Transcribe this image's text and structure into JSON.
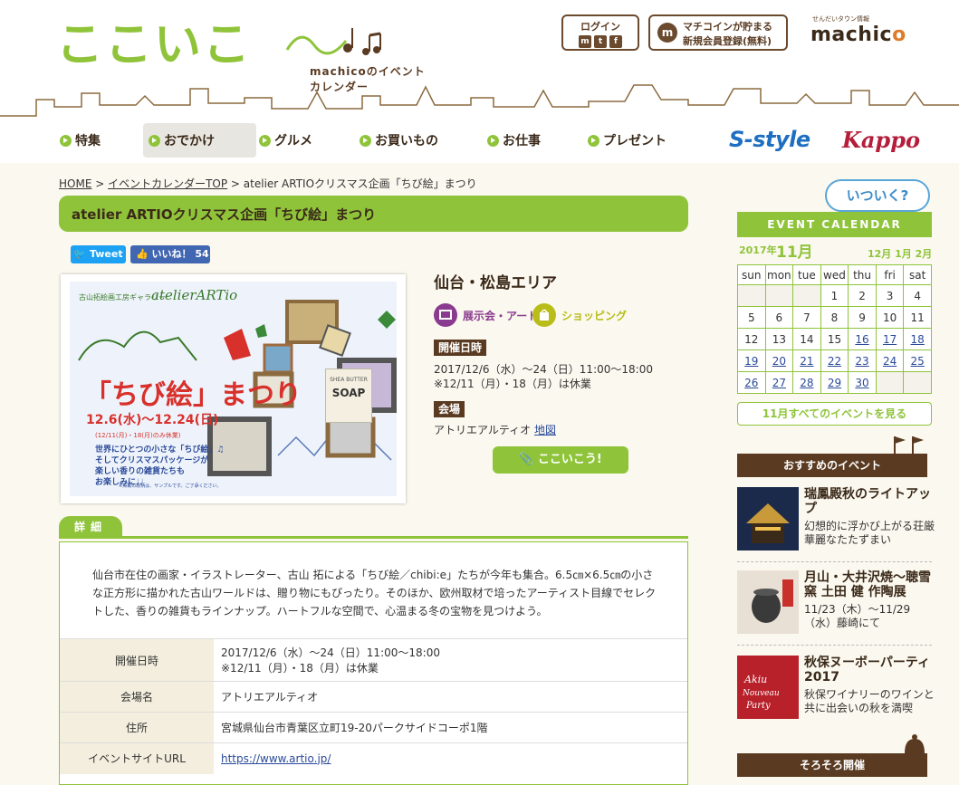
{
  "header": {
    "logo_text": "ここいこ",
    "logo_sub": "machicoのイベントカレンダー",
    "login_label": "ログイン",
    "login_icons": [
      "m",
      "t",
      "f"
    ],
    "register_line1": "マチコインが貯まる",
    "register_line2": "新規会員登録(無料)",
    "machico_small": "せんだいタウン情報",
    "machico_name_a": "machic",
    "machico_name_b": "o"
  },
  "nav": {
    "items": [
      "特集",
      "おでかけ",
      "グルメ",
      "お買いもの",
      "お仕事",
      "プレゼント"
    ],
    "sstyle": "S-style",
    "kappo": "Kappo"
  },
  "breadcrumb": {
    "home": "HOME",
    "sep": " > ",
    "calendar_top": "イベントカレンダーTOP",
    "current": "atelier ARTIOクリスマス企画「ちび絵」まつり"
  },
  "event": {
    "title": "atelier ARTIOクリスマス企画「ちび絵」まつり",
    "tweet_label": "Tweet",
    "like_label": "いいね！ 54",
    "area": "仙台・松島エリア",
    "categories": [
      {
        "label": "展示会・アート",
        "color": "#8a3b8f"
      },
      {
        "label": "ショッピング",
        "color": "#b8bd1a"
      }
    ],
    "date_label": "開催日時",
    "date_line1": "2017/12/6（水）～24（日）11:00～18:00",
    "date_line2": "※12/11（月）・18（月）は休業",
    "venue_label": "会場",
    "venue": "アトリエアルティオ",
    "map_link": "地図",
    "koko_button": "ここいこう!"
  },
  "poster": {
    "gallery": "古山拓絵画工房ギャラリー",
    "artio": "atelierARTio",
    "chibi": "「ちび絵」まつり",
    "dates": "12.6(水)～12.24(日)",
    "closed": "(12/11(月)・18(月)のみ休業)",
    "copy1": "世界にひとつの小さな「ちび絵」♫",
    "copy2": "そしてクリスマスパッケージが",
    "copy3": "楽しい香りの雑貨たちも",
    "copy4": "お楽しみに♩♩",
    "soap_top": "SHEA BUTTER",
    "soap": "SOAP",
    "note": "※掲載の絵柄は、サンプルです。ご了承ください。"
  },
  "detail": {
    "tab": "詳細",
    "desc": "仙台市在住の画家・イラストレーター、古山 拓による「ちび絵／chibi:e」たちが今年も集合。6.5㎝×6.5㎝の小さな正方形に描かれた古山ワールドは、贈り物にもぴったり。そのほか、欧州取材で培ったアーティスト目線でセレクトした、香りの雑貨もラインナップ。ハートフルな空間で、心温まる冬の宝物を見つけよう。",
    "rows": [
      {
        "key": "開催日時",
        "val1": "2017/12/6（水）～24（日）11:00～18:00",
        "val2": "※12/11（月）・18（月）は休業"
      },
      {
        "key": "会場名",
        "val1": "アトリエアルティオ"
      },
      {
        "key": "住所",
        "val1": "宮城県仙台市青葉区立町19-20パークサイドコーポ1階"
      },
      {
        "key": "イベントサイトURL",
        "val1": "https://www.artio.jp/"
      }
    ]
  },
  "calendar": {
    "bubble": "いついく?",
    "head": "EVENT CALENDAR",
    "year": "2017年",
    "month": "11月",
    "other_months": "12月 1月 2月",
    "dow": [
      "sun",
      "mon",
      "tue",
      "wed",
      "thu",
      "fri",
      "sat"
    ],
    "weeks": [
      [
        "",
        "",
        "",
        "1",
        "2",
        "3",
        "4"
      ],
      [
        "5",
        "6",
        "7",
        "8",
        "9",
        "10",
        "11"
      ],
      [
        "12",
        "13",
        "14",
        "15",
        "16",
        "17",
        "18"
      ],
      [
        "19",
        "20",
        "21",
        "22",
        "23",
        "24",
        "25"
      ],
      [
        "26",
        "27",
        "28",
        "29",
        "30",
        "",
        ""
      ]
    ],
    "all_link": "11月すべてのイベントを見る"
  },
  "sidebar": {
    "recommend_label": "おすすめのイベント",
    "soon_label": "そろそろ開催",
    "events": [
      {
        "title": "瑞鳳殿秋のライトアップ",
        "desc": "幻想的に浮かび上がる荘厳華麗なたたずまい"
      },
      {
        "title": "月山・大井沢焼～聴雪窯 土田 健 作陶展",
        "desc": "11/23（木）～11/29（水）藤崎にて"
      },
      {
        "title": "秋保ヌーボーパーティ2017",
        "desc": "秋保ワイナリーのワインと共に出会いの秋を満喫"
      }
    ]
  },
  "colors": {
    "green": "#8fc43a",
    "brown": "#5a3b22",
    "link": "#2a4a9a"
  }
}
